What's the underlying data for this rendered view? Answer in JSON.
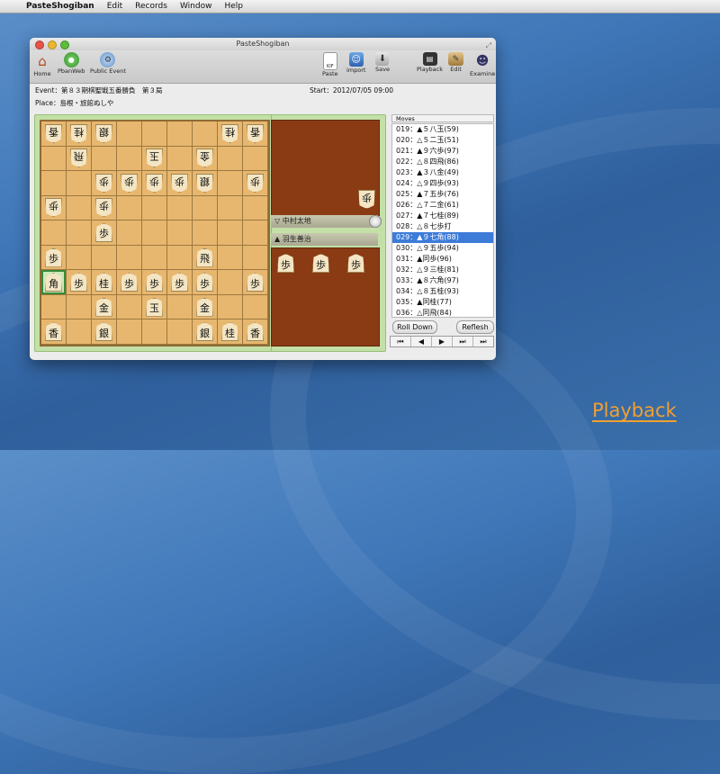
{
  "menubar": {
    "app": "PasteShogiban",
    "items": [
      "Edit",
      "Records",
      "Window",
      "Help"
    ]
  },
  "window": {
    "title": "PasteShogiban"
  },
  "toolbar": {
    "left": [
      {
        "label": "Home",
        "icon": "home-icon"
      },
      {
        "label": "PbanWeb",
        "icon": "pbanweb-icon"
      },
      {
        "label": "Public Event",
        "icon": "public-event-icon"
      }
    ],
    "right": [
      {
        "label": "Paste",
        "icon": "paste-icon",
        "badge": "KIF"
      },
      {
        "label": "import",
        "icon": "import-icon"
      },
      {
        "label": "Save",
        "icon": "save-icon"
      },
      {
        "label": "Playback",
        "icon": "playback-icon"
      },
      {
        "label": "Edit",
        "icon": "edit-icon"
      },
      {
        "label": "Examine",
        "icon": "examine-icon"
      }
    ]
  },
  "game": {
    "event": "Event：第８３期棋聖戦五番勝負　第３局",
    "start": "Start：2012/07/05 09:00",
    "place": "Place：島根・旅館ぬしや"
  },
  "board": [
    [
      "香g",
      "桂g",
      "銀g",
      "",
      "",
      "",
      "",
      "桂g",
      "香g"
    ],
    [
      "",
      "飛g",
      "",
      "",
      "玉g",
      "",
      "金g",
      "",
      ""
    ],
    [
      "",
      "",
      "歩g",
      "歩g",
      "歩g",
      "歩g",
      "銀g",
      "",
      "歩g"
    ],
    [
      "歩g",
      "",
      "歩g",
      "",
      "",
      "",
      "",
      "",
      ""
    ],
    [
      "",
      "",
      "歩",
      "",
      "",
      "",
      "",
      "",
      ""
    ],
    [
      "歩",
      "",
      "",
      "",
      "",
      "",
      "飛",
      "",
      ""
    ],
    [
      "角",
      "歩",
      "桂",
      "歩",
      "歩",
      "歩",
      "歩",
      "",
      "歩"
    ],
    [
      "",
      "",
      "金",
      "",
      "玉",
      "",
      "金",
      "",
      ""
    ],
    [
      "香",
      "",
      "銀",
      "",
      "",
      "",
      "銀",
      "桂",
      "香"
    ]
  ],
  "highlight": {
    "row": 6,
    "col": 0
  },
  "players": {
    "gote": "▽ 中村太地",
    "sente": "▲ 羽生善治"
  },
  "hands": {
    "gote": [
      "歩"
    ],
    "sente": [
      "歩",
      "歩",
      "歩"
    ]
  },
  "moves": {
    "header": "Moves",
    "items": [
      "019：▲５八玉(59)",
      "020：△５二玉(51)",
      "021：▲９六歩(97)",
      "022：△８四飛(86)",
      "023：▲３八金(49)",
      "024：△９四歩(93)",
      "025：▲７五歩(76)",
      "026：△７二金(61)",
      "027：▲７七桂(89)",
      "028：△８七歩打",
      "029：▲９七角(88)",
      "030：△９五歩(94)",
      "031：▲同歩(96)",
      "032：△９三桂(81)",
      "033：▲８六角(97)",
      "034：△８五桂(93)",
      "035：▲同桂(77)",
      "036：△同飛(84)"
    ],
    "selected": 10
  },
  "buttons": {
    "roll_down": "Roll Down",
    "refresh": "Reflesh"
  },
  "nav": [
    "⏮",
    "◀",
    "▶",
    "⏭",
    "⏭"
  ],
  "overlay_link": "Playback",
  "colors": {
    "selection": "#3d7bd8",
    "board": "#e7b76f",
    "hand_bg": "#8a3b14",
    "frame": "#c3e0a7",
    "link": "#f0a030"
  }
}
